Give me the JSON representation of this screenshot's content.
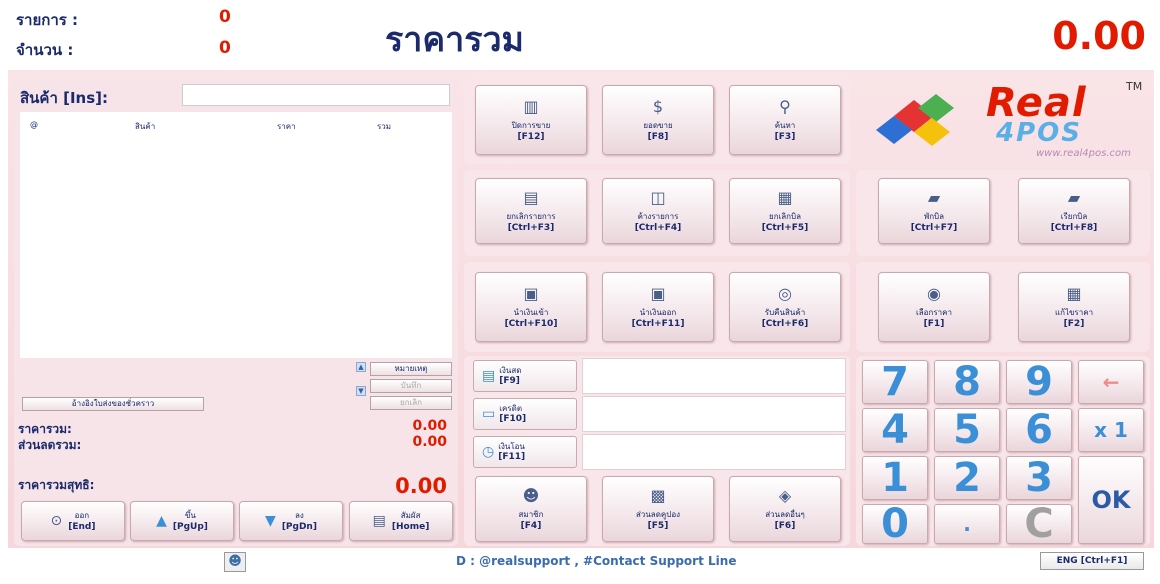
{
  "header": {
    "items_label": "รายการ :",
    "items_value": "0",
    "qty_label": "จำนวน :",
    "qty_value": "0",
    "title": "ราคารวม",
    "total": "0.00"
  },
  "product": {
    "label": "สินค้า [Ins]:",
    "input_value": "",
    "columns": [
      "@",
      "สินค้า",
      "ราคา",
      "รวม"
    ]
  },
  "list_side_buttons": {
    "note": "หมายเหตุ",
    "save": "บันทึก",
    "cancel": "ยกเลิก"
  },
  "ref_button": "อ้างอิงใบส่งของชั่วคราว",
  "summary": {
    "subtotal_label": "ราคารวม:",
    "subtotal_value": "0.00",
    "discount_label": "ส่วนลดรวม:",
    "discount_value": "0.00",
    "net_label": "ราคารวมสุทธิ:",
    "net_value": "0.00"
  },
  "bottom_buttons": [
    {
      "label": "ออก",
      "key": "[End]",
      "icon": "exit-icon"
    },
    {
      "label": "ขึ้น",
      "key": "[PgUp]",
      "icon": "arrow-up-icon"
    },
    {
      "label": "ลง",
      "key": "[PgDn]",
      "icon": "arrow-down-icon"
    },
    {
      "label": "สัมผัส",
      "key": "[Home]",
      "icon": "touch-icon"
    }
  ],
  "function_buttons": {
    "close_sale": {
      "label": "ปิดการขาย",
      "key": "[F12]",
      "icon": "document-icon"
    },
    "sales": {
      "label": "ยอดขาย",
      "key": "[F8]",
      "icon": "money-icon"
    },
    "search": {
      "label": "ค้นหา",
      "key": "[F3]",
      "icon": "search-icon"
    },
    "cancel_item": {
      "label": "ยกเลิกรายการ",
      "key": "[Ctrl+F3]",
      "icon": "cancel-item-icon"
    },
    "hold_item": {
      "label": "ค้างรายการ",
      "key": "[Ctrl+F4]",
      "icon": "cup-icon"
    },
    "cancel_bill": {
      "label": "ยกเลิกบิล",
      "key": "[Ctrl+F5]",
      "icon": "cancel-bill-icon"
    },
    "suspend_bill": {
      "label": "พักบิล",
      "key": "[Ctrl+F7]",
      "icon": "folder-icon"
    },
    "recall_bill": {
      "label": "เรียกบิล",
      "key": "[Ctrl+F8]",
      "icon": "recall-icon"
    },
    "cash_in": {
      "label": "นำเงินเข้า",
      "key": "[Ctrl+F10]",
      "icon": "printer-icon"
    },
    "cash_out": {
      "label": "นำเงินออก",
      "key": "[Ctrl+F11]",
      "icon": "printer-icon"
    },
    "return_goods": {
      "label": "รับคืนสินค้า",
      "key": "[Ctrl+F6]",
      "icon": "return-icon"
    },
    "select_price": {
      "label": "เลือกราคา",
      "key": "[F1]",
      "icon": "radio-icon"
    },
    "edit_price": {
      "label": "แก้ไขราคา",
      "key": "[F2]",
      "icon": "calculator-icon"
    },
    "member": {
      "label": "สมาชิก",
      "key": "[F4]",
      "icon": "member-icon"
    },
    "coupon": {
      "label": "ส่วนลดคูปอง",
      "key": "[F5]",
      "icon": "coupon-icon"
    },
    "other_discount": {
      "label": "ส่วนลดอื่นๆ",
      "key": "[F6]",
      "icon": "discount-icon"
    }
  },
  "payments": [
    {
      "label": "เงินสด",
      "key": "[F9]",
      "icon": "cash-icon",
      "value": ""
    },
    {
      "label": "เครดิต",
      "key": "[F10]",
      "icon": "credit-card-icon",
      "value": ""
    },
    {
      "label": "เงินโอน",
      "key": "[F11]",
      "icon": "transfer-icon",
      "value": ""
    }
  ],
  "keypad": {
    "keys": [
      "7",
      "8",
      "9",
      "←",
      "4",
      "5",
      "6",
      "x 1",
      "1",
      "2",
      "3",
      "OK",
      "0",
      ".",
      "C"
    ]
  },
  "logo": {
    "brand": "Real",
    "sub": "4POS",
    "tm": "TM",
    "url": "www.real4pos.com"
  },
  "footer": {
    "support": "D : @realsupport ,   #Contact Support Line",
    "lang": "ENG [Ctrl+F1]"
  },
  "colors": {
    "accent": "#1a2a6c",
    "price": "#e01b00",
    "keypad": "#3b8fd6",
    "panel": "#f7dde1"
  }
}
